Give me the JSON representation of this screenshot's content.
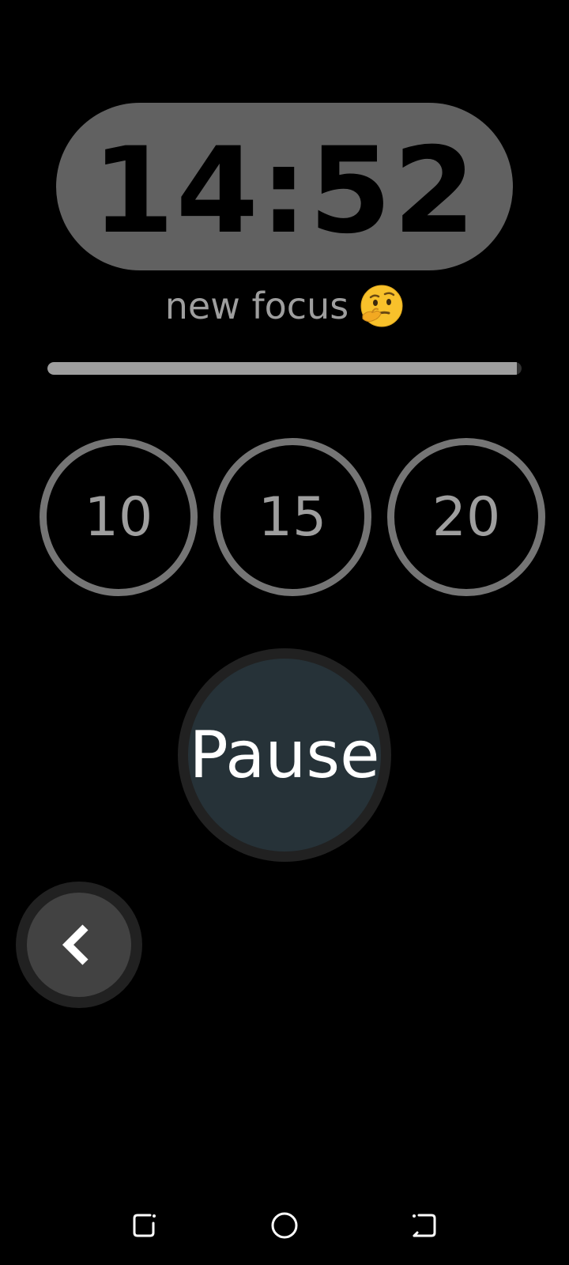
{
  "timer": {
    "display": "14:52"
  },
  "session": {
    "label": "new focus",
    "emoji_icon": "thinking-face-icon"
  },
  "progress": {
    "fraction": 0.99
  },
  "presets": [
    {
      "label": "10"
    },
    {
      "label": "15"
    },
    {
      "label": "20"
    }
  ],
  "controls": {
    "pause_label": "Pause",
    "back_icon": "chevron-left-icon"
  },
  "navbar": {
    "recents_icon": "recents-icon",
    "home_icon": "home-icon",
    "back_icon": "back-icon"
  },
  "colors": {
    "background": "#000000",
    "timer_pill": "#616161",
    "pause_button": "#263238",
    "preset_ring": "#757575",
    "progress_fill": "#9e9e9e"
  }
}
